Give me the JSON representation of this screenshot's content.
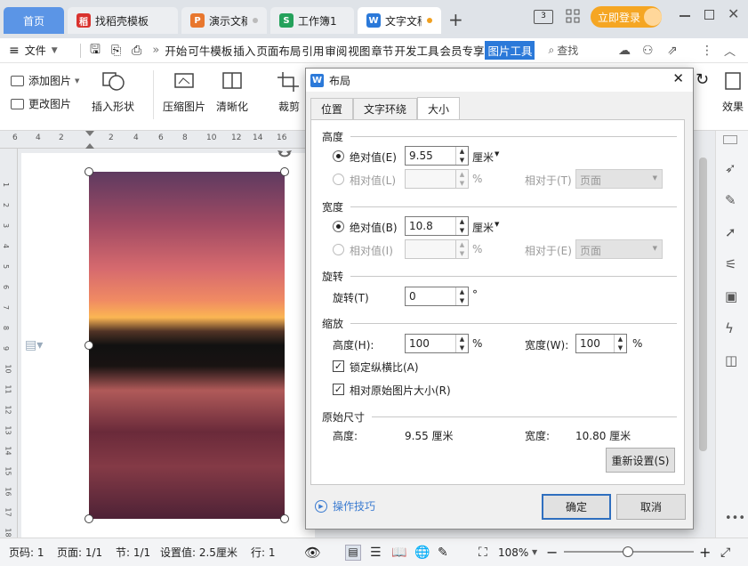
{
  "tabs": {
    "home": "首页",
    "find_template": "找稻壳模板",
    "presentation": "演示文稿",
    "workbook": "工作簿1",
    "document": "文字文稿",
    "new_tab": "+"
  },
  "titlebar": {
    "layout_mode": "3⃞",
    "login": "立即登录"
  },
  "menubar": {
    "file": "文件",
    "items": [
      "开始",
      "可牛模板",
      "插入",
      "页面布局",
      "引用",
      "审阅",
      "视图",
      "章节",
      "开发工具",
      "会员专享",
      "图片工具"
    ],
    "active_item": "图片工具",
    "search": "查找"
  },
  "ribbon": {
    "add_picture": "添加图片",
    "change_picture": "更改图片",
    "insert_shape": "插入形状",
    "compress_picture": "压缩图片",
    "sharpen": "清晰化",
    "crop": "裁剪",
    "effects": "效果"
  },
  "ruler": {
    "numbers": [
      "6",
      "4",
      "2",
      "2",
      "4",
      "6",
      "8",
      "10",
      "12",
      "14",
      "16"
    ],
    "vnumbers": [
      "1",
      "2",
      "3",
      "4",
      "5",
      "6",
      "7",
      "8",
      "9",
      "10",
      "11",
      "12",
      "13",
      "14",
      "15",
      "16",
      "17",
      "18"
    ]
  },
  "dialog": {
    "title": "布局",
    "tabs": [
      "位置",
      "文字环绕",
      "大小"
    ],
    "active_tab": "大小",
    "height": {
      "section": "高度",
      "absolute_label": "绝对值(E)",
      "absolute_value": "9.55",
      "unit": "厘米",
      "relative_label": "相对值(L)",
      "percent": "%",
      "relative_to_label": "相对于(T)",
      "relative_to_value": "页面"
    },
    "width": {
      "section": "宽度",
      "absolute_label": "绝对值(B)",
      "absolute_value": "10.8",
      "unit": "厘米",
      "relative_label": "相对值(I)",
      "percent": "%",
      "relative_to_label": "相对于(E)",
      "relative_to_value": "页面"
    },
    "rotation": {
      "section": "旋转",
      "label": "旋转(T)",
      "value": "0",
      "unit": "°"
    },
    "scale": {
      "section": "缩放",
      "height_label": "高度(H):",
      "height_value": "100",
      "width_label": "宽度(W):",
      "width_value": "100",
      "percent": "%",
      "lock_aspect": "锁定纵横比(A)",
      "relative_original": "相对原始图片大小(R)"
    },
    "original": {
      "section": "原始尺寸",
      "height_label": "高度:",
      "height_value": "9.55 厘米",
      "width_label": "宽度:",
      "width_value": "10.80 厘米",
      "reset": "重新设置(S)"
    },
    "tips": "操作技巧",
    "ok": "确定",
    "cancel": "取消"
  },
  "status": {
    "page_no": "页码: 1",
    "pages": "页面: 1/1",
    "section": "节: 1/1",
    "setting": "设置值: 2.5厘米",
    "line": "行: 1",
    "zoom": "108%"
  },
  "colors": {
    "accent_blue": "#2b79d9",
    "active_tab_orange": "#f0a020",
    "login_orange": "#f5a623"
  }
}
